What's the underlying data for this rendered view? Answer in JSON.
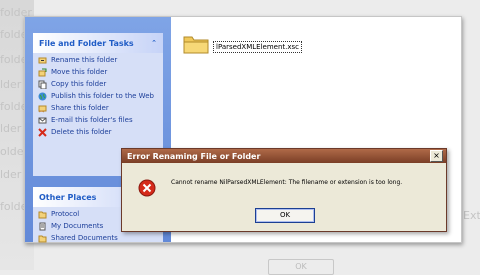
{
  "background": {
    "ghost_labels": [
      "folder",
      "folder",
      "folder",
      "lder",
      "folder",
      "lder",
      "older",
      "lder",
      "folder",
      "Ext"
    ],
    "ghost_button": "OK"
  },
  "taskpane": {
    "file_tasks": {
      "title": "File and Folder Tasks",
      "collapse_icon": "chevron-up-icon",
      "items": [
        {
          "label": "Rename this folder",
          "icon": "rename-icon"
        },
        {
          "label": "Move this folder",
          "icon": "move-icon"
        },
        {
          "label": "Copy this folder",
          "icon": "copy-icon"
        },
        {
          "label": "Publish this folder to the Web",
          "icon": "globe-icon"
        },
        {
          "label": "Share this folder",
          "icon": "share-icon"
        },
        {
          "label": "E-mail this folder's files",
          "icon": "mail-icon"
        },
        {
          "label": "Delete this folder",
          "icon": "delete-icon"
        }
      ]
    },
    "other_places": {
      "title": "Other Places",
      "collapse_icon": "chevron-up-icon",
      "items": [
        {
          "label": "Protocol",
          "icon": "folder-icon"
        },
        {
          "label": "My Documents",
          "icon": "documents-icon"
        },
        {
          "label": "Shared Documents",
          "icon": "shared-folder-icon"
        }
      ]
    }
  },
  "contents": {
    "folder_name": "lParsedXMLElement.xsc"
  },
  "dialog": {
    "title": "Error Renaming File or Folder",
    "message": "Cannot rename NilParsedXMLElement: The filename or extension is too long.",
    "ok_label": "OK",
    "close_label": "×",
    "icon": "error-icon"
  },
  "colors": {
    "taskpane_blue": "#6f96de",
    "link_blue": "#1d3f9a",
    "dialog_title": "#8a4a30",
    "error_red": "#d52a1a"
  }
}
